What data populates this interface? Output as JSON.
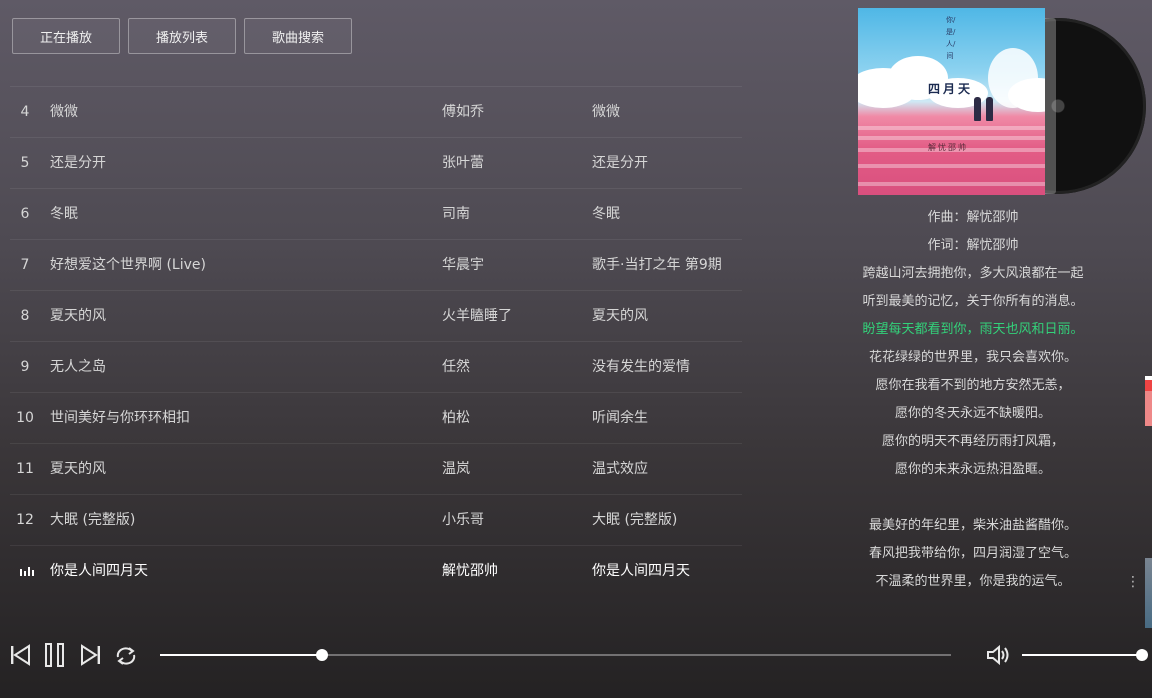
{
  "tabs": [
    {
      "label": "正在播放"
    },
    {
      "label": "播放列表"
    },
    {
      "label": "歌曲搜索"
    }
  ],
  "songs": [
    {
      "index": "4",
      "name": "微微",
      "artist": "傅如乔",
      "album": "微微"
    },
    {
      "index": "5",
      "name": "还是分开",
      "artist": "张叶蕾",
      "album": "还是分开"
    },
    {
      "index": "6",
      "name": "冬眠",
      "artist": "司南",
      "album": "冬眠"
    },
    {
      "index": "7",
      "name": "好想爱这个世界啊 (Live)",
      "artist": "华晨宇",
      "album": "歌手·当打之年 第9期"
    },
    {
      "index": "8",
      "name": "夏天的风",
      "artist": "火羊瞌睡了",
      "album": "夏天的风"
    },
    {
      "index": "9",
      "name": "无人之岛",
      "artist": "任然",
      "album": "没有发生的爱情"
    },
    {
      "index": "10",
      "name": "世间美好与你环环相扣",
      "artist": "柏松",
      "album": "听闻余生"
    },
    {
      "index": "11",
      "name": "夏天的风",
      "artist": "温岚",
      "album": "温式效应"
    },
    {
      "index": "12",
      "name": "大眠 (完整版)",
      "artist": "小乐哥",
      "album": "大眠 (完整版)"
    },
    {
      "index": "",
      "name": "你是人间四月天",
      "artist": "解忧邵帅",
      "album": "你是人间四月天",
      "playing": true
    }
  ],
  "cover": {
    "title": "四月天",
    "vertical_text": "你/是/人/间",
    "signature": "解忧邵帅"
  },
  "lyrics": {
    "lines": [
      "作曲：解忧邵帅",
      "作词：解忧邵帅",
      "跨越山河去拥抱你，多大风浪都在一起",
      "听到最美的记忆，关于你所有的消息。",
      "盼望每天都看到你，雨天也风和日丽。",
      "花花绿绿的世界里，我只会喜欢你。",
      "愿你在我看不到的地方安然无恙，",
      "愿你的冬天永远不缺暖阳。",
      "愿你的明天不再经历雨打风霜，",
      "愿你的未来永远热泪盈眶。",
      "",
      "最美好的年纪里，柴米油盐酱醋你。",
      "春风把我带给你，四月润湿了空气。",
      "不温柔的世界里，你是我的运气。"
    ],
    "active_index": 4,
    "active_color": "#33d17a"
  },
  "player": {
    "progress": 0.205,
    "volume": 1.0,
    "icons": [
      "prev-icon",
      "pause-icon",
      "next-icon",
      "repeat-icon",
      "volume-icon"
    ]
  }
}
